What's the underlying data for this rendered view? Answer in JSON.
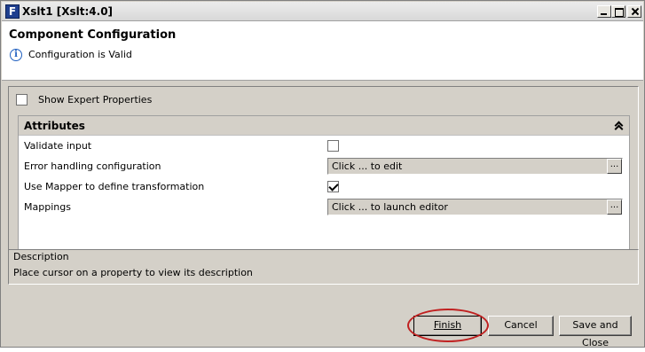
{
  "window": {
    "title": "Xslt1 [Xslt:4.0]",
    "icon": "app-icon",
    "accent_color": "#c02020"
  },
  "header": {
    "title": "Component Configuration",
    "status": "Configuration is Valid",
    "status_icon": "info-icon"
  },
  "options": {
    "show_expert_label": "Show Expert Properties",
    "show_expert_checked": false
  },
  "attributes": {
    "title": "Attributes",
    "rows": [
      {
        "label": "Validate input",
        "type": "checkbox",
        "checked": false
      },
      {
        "label": "Error handling configuration",
        "type": "field",
        "value": "Click ... to edit",
        "button": "..."
      },
      {
        "label": "Use Mapper to define transformation",
        "type": "checkbox",
        "checked": true
      },
      {
        "label": "Mappings",
        "type": "field",
        "value": "Click ... to launch editor",
        "button": "..."
      }
    ]
  },
  "description": {
    "title": "Description",
    "text": "Place cursor on a property to view its description"
  },
  "buttons": {
    "finish": "Finish",
    "cancel": "Cancel",
    "save_close": "Save and Close"
  }
}
